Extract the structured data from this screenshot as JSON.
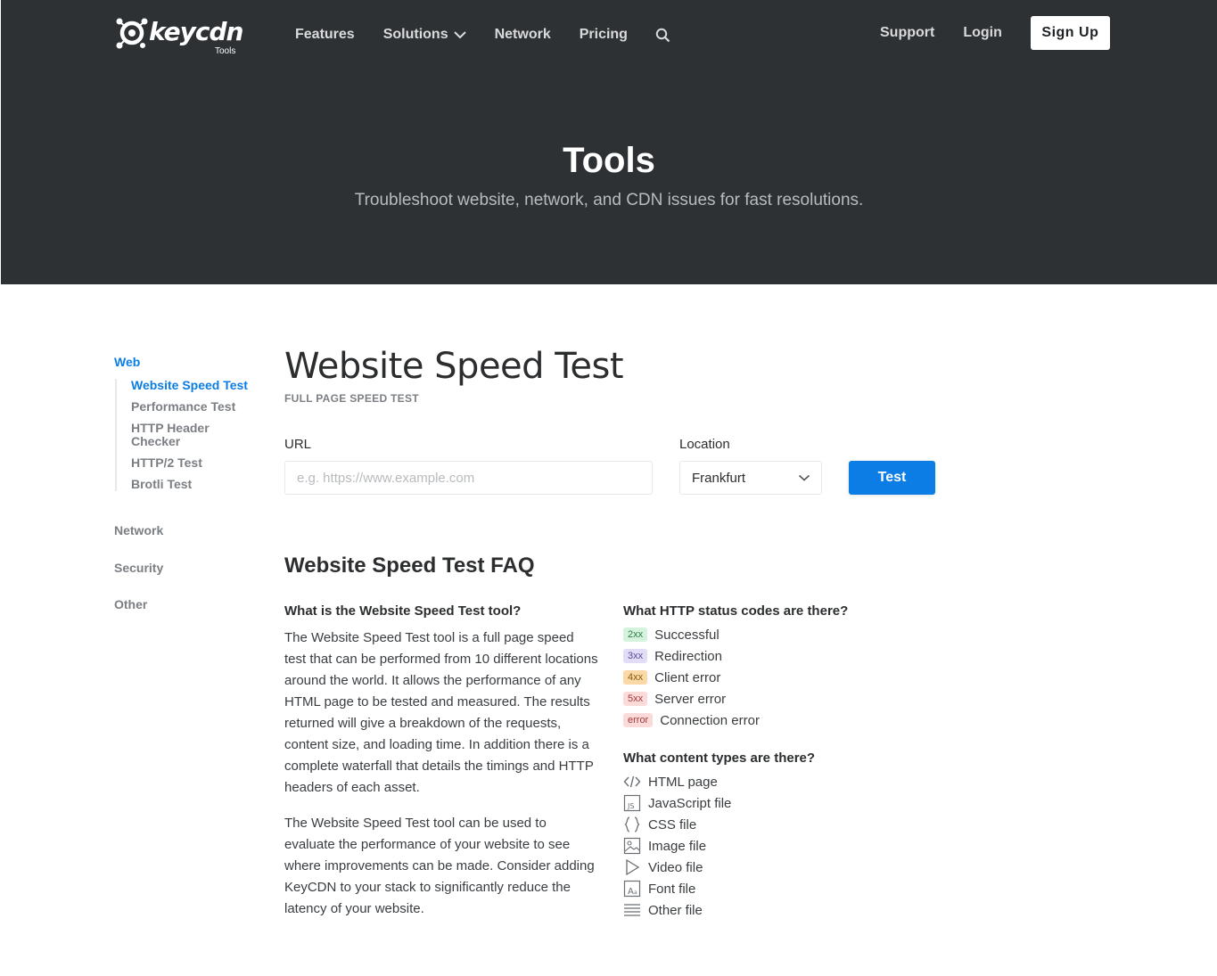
{
  "brand": {
    "name": "keycdn",
    "sub": "Tools"
  },
  "nav": {
    "features": "Features",
    "solutions": "Solutions",
    "network": "Network",
    "pricing": "Pricing",
    "support": "Support",
    "login": "Login",
    "signup": "Sign Up"
  },
  "hero": {
    "title": "Tools",
    "subtitle": "Troubleshoot website, network, and CDN issues for fast resolutions."
  },
  "sidebar": {
    "web": "Web",
    "web_items": [
      "Website Speed Test",
      "Performance Test",
      "HTTP Header Checker",
      "HTTP/2 Test",
      "Brotli Test"
    ],
    "network": "Network",
    "security": "Security",
    "other": "Other"
  },
  "main": {
    "title": "Website Speed Test",
    "kicker": "FULL PAGE SPEED TEST",
    "url_label": "URL",
    "url_placeholder": "e.g. https://www.example.com",
    "location_label": "Location",
    "location_value": "Frankfurt",
    "test_button": "Test"
  },
  "faq": {
    "title": "Website Speed Test FAQ",
    "q1": "What is the Website Speed Test tool?",
    "p1": "The Website Speed Test tool is a full page speed test that can be performed from 10 different locations around the world. It allows the performance of any HTML page to be tested and measured. The results returned will give a breakdown of the requests, content size, and loading time. In addition there is a complete waterfall that details the timings and HTTP headers of each asset.",
    "p2": "The Website Speed Test tool can be used to evaluate the performance of your website to see where improvements can be made. Consider adding KeyCDN to your stack to significantly reduce the latency of your website.",
    "q2": "What HTTP status codes are there?",
    "statuses": [
      {
        "code": "2xx",
        "label": "Successful",
        "bg": "#d5f2dd",
        "fg": "#2e7d46"
      },
      {
        "code": "3xx",
        "label": "Redirection",
        "bg": "#e3dcf7",
        "fg": "#5b4b9a"
      },
      {
        "code": "4xx",
        "label": "Client error",
        "bg": "#fbd9a6",
        "fg": "#8a5a12"
      },
      {
        "code": "5xx",
        "label": "Server error",
        "bg": "#fbdada",
        "fg": "#a33a3a"
      },
      {
        "code": "error",
        "label": "Connection error",
        "bg": "#fbdada",
        "fg": "#a33a3a"
      }
    ],
    "q3": "What content types are there?",
    "content_types": [
      {
        "icon": "code-icon",
        "label": "HTML page"
      },
      {
        "icon": "js-file-icon",
        "label": "JavaScript file"
      },
      {
        "icon": "braces-icon",
        "label": "CSS file"
      },
      {
        "icon": "image-icon",
        "label": "Image file"
      },
      {
        "icon": "play-icon",
        "label": "Video file"
      },
      {
        "icon": "font-icon",
        "label": "Font file"
      },
      {
        "icon": "lines-icon",
        "label": "Other file"
      }
    ]
  },
  "colors": {
    "header_bg": "#2e3133",
    "accent": "#0b7de4"
  }
}
